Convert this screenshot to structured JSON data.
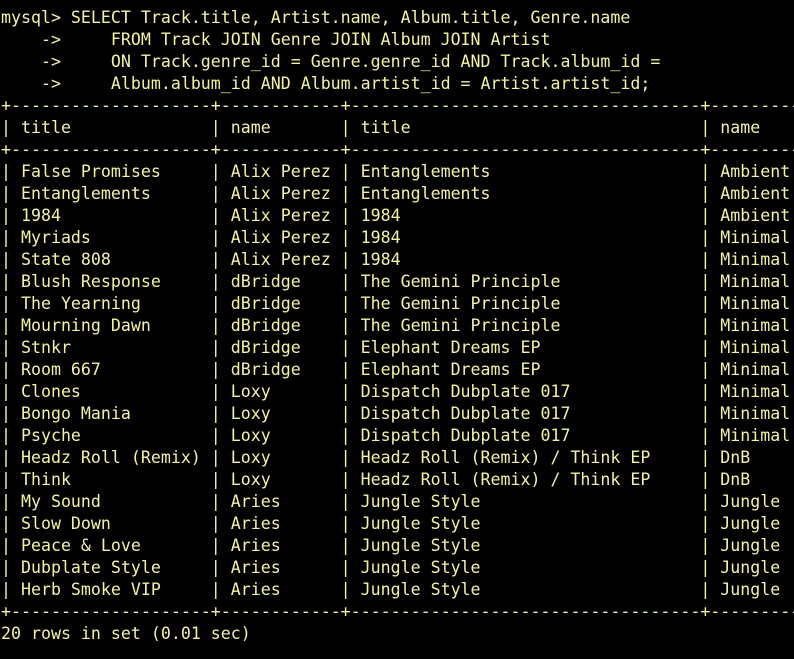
{
  "terminal": {
    "colors": {
      "background": "#000000",
      "text": "#f3f3a0"
    },
    "query_lines": [
      "mysql> SELECT Track.title, Artist.name, Album.title, Genre.name",
      "    ->     FROM Track JOIN Genre JOIN Album JOIN Artist",
      "    ->     ON Track.genre_id = Genre.genre_id AND Track.album_id =",
      "    ->     Album.album_id AND Album.artist_id = Artist.artist_id;"
    ],
    "table": {
      "border": "+--------------------+------------+-----------------------------------+-----------+",
      "header_line": "| title              | name       | title                             | name      |",
      "columns": [
        "title",
        "name",
        "title",
        "name"
      ],
      "row_lines": [
        "| False Promises     | Alix Perez | Entanglements                     | Ambient   |",
        "| Entanglements      | Alix Perez | Entanglements                     | Ambient   |",
        "| 1984               | Alix Perez | 1984                              | Ambient   |",
        "| Myriads            | Alix Perez | 1984                              | Minimal   |",
        "| State 808          | Alix Perez | 1984                              | Minimal   |",
        "| Blush Response     | dBridge    | The Gemini Principle              | Minimal   |",
        "| The Yearning       | dBridge    | The Gemini Principle              | Minimal   |",
        "| Mourning Dawn      | dBridge    | The Gemini Principle              | Minimal   |",
        "| Stnkr              | dBridge    | Elephant Dreams EP                | Minimal   |",
        "| Room 667           | dBridge    | Elephant Dreams EP                | Minimal   |",
        "| Clones             | Loxy       | Dispatch Dubplate 017             | Minimal   |",
        "| Bongo Mania        | Loxy       | Dispatch Dubplate 017             | Minimal   |",
        "| Psyche             | Loxy       | Dispatch Dubplate 017             | Minimal   |",
        "| Headz Roll (Remix) | Loxy       | Headz Roll (Remix) / Think EP     | DnB       |",
        "| Think              | Loxy       | Headz Roll (Remix) / Think EP     | DnB       |",
        "| My Sound           | Aries      | Jungle Style                      | Jungle    |",
        "| Slow Down          | Aries      | Jungle Style                      | Jungle    |",
        "| Peace & Love       | Aries      | Jungle Style                      | Jungle    |",
        "| Dubplate Style     | Aries      | Jungle Style                      | Jungle    |",
        "| Herb Smoke VIP     | Aries      | Jungle Style                      | Jungle    |"
      ]
    },
    "footer": "20 rows in set (0.01 sec)"
  }
}
